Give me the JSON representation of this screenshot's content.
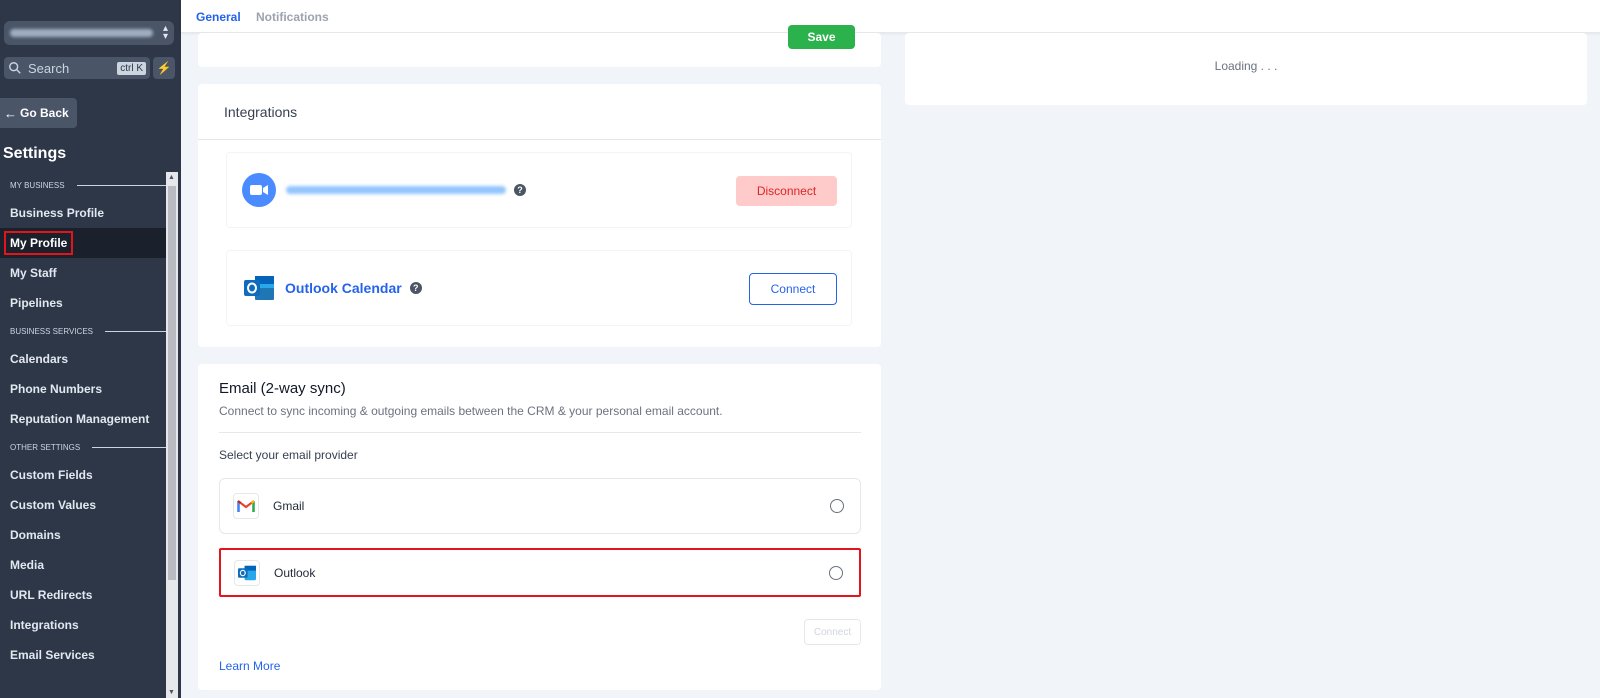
{
  "sidebar": {
    "search_placeholder": "Search",
    "search_shortcut": "ctrl K",
    "go_back": "Go Back",
    "title": "Settings",
    "sections": [
      {
        "label": "MY BUSINESS",
        "items": [
          "Business Profile",
          "My Profile",
          "My Staff",
          "Pipelines"
        ]
      },
      {
        "label": "BUSINESS SERVICES",
        "items": [
          "Calendars",
          "Phone Numbers",
          "Reputation Management"
        ]
      },
      {
        "label": "OTHER SETTINGS",
        "items": [
          "Custom Fields",
          "Custom Values",
          "Domains",
          "Media",
          "URL Redirects",
          "Integrations",
          "Email Services"
        ]
      }
    ],
    "active_item": "My Profile"
  },
  "tabs": {
    "general": "General",
    "notifications": "Notifications"
  },
  "top_card": {
    "save": "Save"
  },
  "loading": {
    "text": "Loading . . ."
  },
  "integrations": {
    "title": "Integrations",
    "zoom": {
      "disconnect": "Disconnect"
    },
    "outlook_calendar": {
      "label": "Outlook Calendar",
      "connect": "Connect"
    }
  },
  "email": {
    "title": "Email (2-way sync)",
    "subtitle": "Connect to sync incoming & outgoing emails between the CRM & your personal email account.",
    "select_label": "Select your email provider",
    "providers": [
      {
        "label": "Gmail"
      },
      {
        "label": "Outlook"
      }
    ],
    "connect": "Connect",
    "learn_more": "Learn More"
  },
  "colors": {
    "accent": "#2563eb",
    "save_green": "#2bb24c",
    "highlight_red": "#e3141a",
    "sidebar_bg": "#2d3748"
  }
}
